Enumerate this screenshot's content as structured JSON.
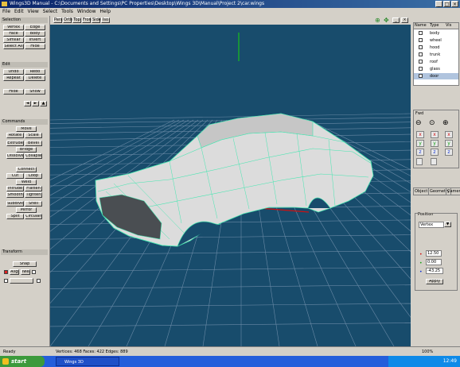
{
  "window": {
    "title": "Wings3D Manual - C:\\Documents and Settings\\PC Properties\\Desktop\\Wings 3D\\Manual\\Project 2\\car.wings"
  },
  "menu": [
    "File",
    "Edit",
    "View",
    "Select",
    "Tools",
    "Window",
    "Help"
  ],
  "left_panel": {
    "sections": [
      {
        "title": "Selection",
        "buttons": [
          "Vertex",
          "Edge",
          "Face",
          "Body",
          "Similar",
          "Invert",
          "Select All",
          "Hide"
        ]
      },
      {
        "title": "Edit",
        "buttons": [
          "Undo",
          "Redo",
          "Repeat",
          "Delete",
          "Hide",
          "Show"
        ]
      },
      {
        "title": "Commands",
        "buttons": [
          "Move",
          "Rotate",
          "Scale",
          "Extrude",
          "Bevel",
          "Bridge",
          "Dissolve",
          "Collapse",
          "Connect",
          "Cut",
          "Loop",
          "Weld",
          "Intrude",
          "Flatten",
          "Smooth",
          "Tighten",
          "Subdivide",
          "Shell",
          "Mirror",
          "Split",
          "Circularize"
        ]
      },
      {
        "title": "Transform",
        "buttons": [
          "Snap",
          "Align",
          "Tweak"
        ]
      }
    ]
  },
  "viewport": {
    "toolbar": [
      "Persp",
      "Ortho",
      "Top",
      "Front",
      "Side",
      "Iso"
    ]
  },
  "right_panel": {
    "list_headers": [
      "Name",
      "Type",
      "Vis"
    ],
    "list_items": [
      "body",
      "wheel",
      "hood",
      "trunk",
      "roof",
      "glass",
      "door"
    ],
    "nav_labels": [
      "Fwd",
      "Back",
      "Orbit"
    ],
    "tabs": [
      "Object",
      "Geometry",
      "Camera"
    ],
    "fields_label": "Position",
    "fields": [
      "12.50",
      "0.00",
      "-43.25"
    ],
    "apply": "Apply"
  },
  "status": {
    "left": "Ready",
    "mid": "Vertices: 468   Faces: 422   Edges: 889",
    "right": "100%"
  },
  "taskbar": {
    "start": "start",
    "task": "Wings 3D",
    "clock": "12:49"
  },
  "colors": {
    "viewport": "#184c6c",
    "wire": "#44e6b0",
    "grid": "#6a8aa6",
    "mesh": "#dedede"
  }
}
